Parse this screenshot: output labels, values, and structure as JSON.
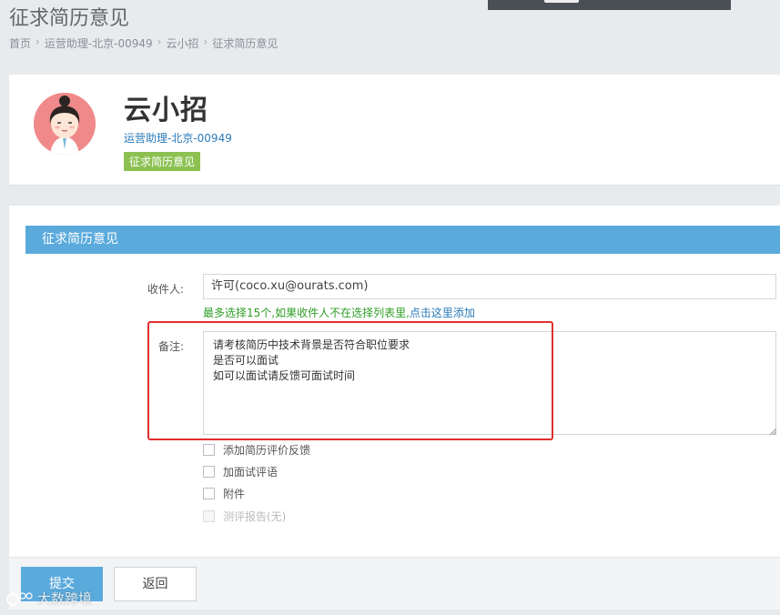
{
  "page": {
    "title": "征求简历意见"
  },
  "breadcrumb": [
    "首页",
    "运营助理-北京-00949",
    "云小招",
    "征求简历意见"
  ],
  "profile": {
    "name": "云小招",
    "job": "运营助理-北京-00949",
    "status": "征求简历意见"
  },
  "form": {
    "section_title": "征求简历意见",
    "recipient_label": "收件人:",
    "recipient_value": "许可(coco.xu@ourats.com)",
    "hint_text": "最多选择15个,如果收件人不在选择列表里,",
    "hint_link": "点击这里添加",
    "remark_label": "备注:",
    "remark_value": "请考核简历中技术背景是否符合职位要求\n是否可以面试\n如可以面试请反馈可面试时间",
    "options": [
      {
        "label": "添加简历评价反馈",
        "checked": false,
        "disabled": false
      },
      {
        "label": "加面试评语",
        "checked": false,
        "disabled": false
      },
      {
        "label": "附件",
        "checked": false,
        "disabled": false
      },
      {
        "label": "测评报告(无)",
        "checked": false,
        "disabled": true
      }
    ]
  },
  "actions": {
    "submit_label": "提交",
    "back_label": "返回"
  },
  "watermark": {
    "text": "大数跨境"
  },
  "colors": {
    "accent": "#5aaadc",
    "status_badge": "#8cc152",
    "hint": "#2f9d27",
    "highlight": "#e02f2f"
  }
}
